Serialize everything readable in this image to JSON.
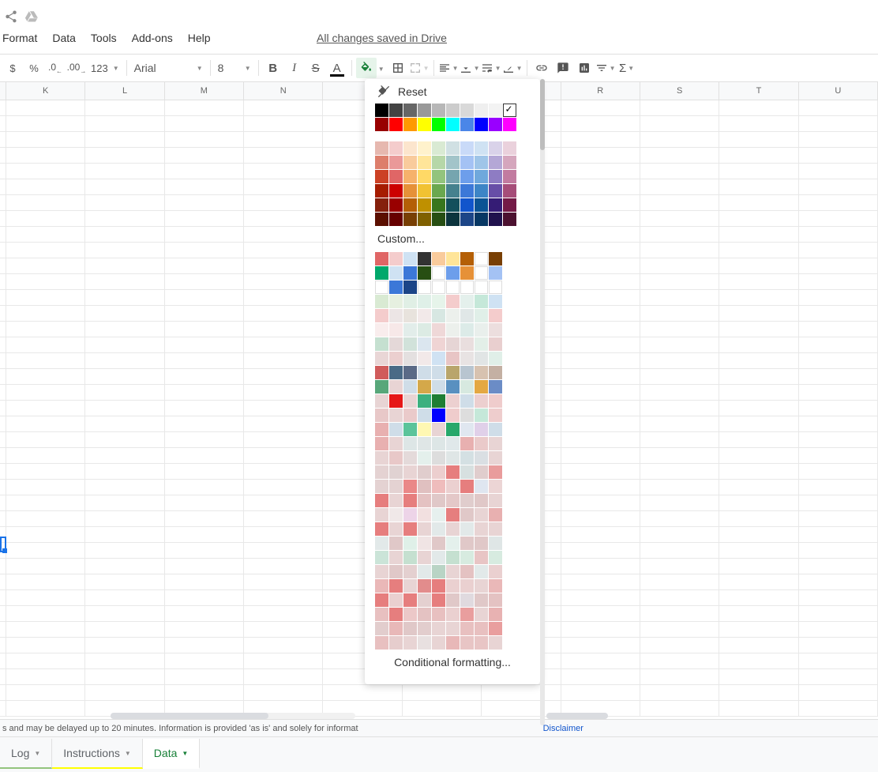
{
  "header": {
    "share_icon": "share-icon",
    "drive_icon": "drive-icon"
  },
  "menu": {
    "format": "Format",
    "data": "Data",
    "tools": "Tools",
    "addons": "Add-ons",
    "help": "Help"
  },
  "save_status": "All changes saved in Drive",
  "toolbar": {
    "percent": "%",
    "dec_less": ".0",
    "dec_more": ".00",
    "more_formats": "123",
    "font": "Arial",
    "size": "8"
  },
  "columns": [
    "K",
    "L",
    "M",
    "N",
    "",
    "",
    "R",
    "S",
    "T",
    "U"
  ],
  "color_picker": {
    "reset_label": "Reset",
    "custom_label": "Custom...",
    "conditional_label": "Conditional formatting...",
    "grays": [
      "#000000",
      "#434343",
      "#666666",
      "#999999",
      "#b7b7b7",
      "#cccccc",
      "#d9d9d9",
      "#efefef",
      "#f3f3f3",
      "#ffffff"
    ],
    "brights": [
      "#980000",
      "#ff0000",
      "#ff9900",
      "#ffff00",
      "#00ff00",
      "#00ffff",
      "#4a86e8",
      "#0000ff",
      "#9900ff",
      "#ff00ff"
    ],
    "palette": [
      [
        "#e6b8af",
        "#f4cccc",
        "#fce5cd",
        "#fff2cc",
        "#d9ead3",
        "#d0e0e3",
        "#c9daf8",
        "#cfe2f3",
        "#d9d2e9",
        "#ead1dc"
      ],
      [
        "#dd7e6b",
        "#ea9999",
        "#f9cb9c",
        "#ffe599",
        "#b6d7a8",
        "#a2c4c9",
        "#a4c2f4",
        "#9fc5e8",
        "#b4a7d6",
        "#d5a6bd"
      ],
      [
        "#cc4125",
        "#e06666",
        "#f6b26b",
        "#ffd966",
        "#93c47d",
        "#76a5af",
        "#6d9eeb",
        "#6fa8dc",
        "#8e7cc3",
        "#c27ba0"
      ],
      [
        "#a61c00",
        "#cc0000",
        "#e69138",
        "#f1c232",
        "#6aa84f",
        "#45818e",
        "#3c78d8",
        "#3d85c6",
        "#674ea7",
        "#a64d79"
      ],
      [
        "#85200c",
        "#990000",
        "#b45f06",
        "#bf9000",
        "#38761d",
        "#134f5c",
        "#1155cc",
        "#0b5394",
        "#351c75",
        "#741b47"
      ],
      [
        "#5b0f00",
        "#660000",
        "#783f04",
        "#7f6000",
        "#274e13",
        "#0c343d",
        "#1c4587",
        "#073763",
        "#20124d",
        "#4c1130"
      ]
    ],
    "custom_colors": [
      [
        "#e06666",
        "#f4cccc",
        "#cfe2f3",
        "#333333",
        "#f9cb9c",
        "#ffe599",
        "#b45f06",
        "#ffffff",
        "#783f04"
      ],
      [
        "#00a86b",
        "#cfe2f3",
        "#3c78d8",
        "#274e13",
        "#ffffff",
        "#6d9eeb",
        "#e69138",
        "#ffffff",
        "#a4c2f4"
      ],
      [
        "#ffffff",
        "#3c78d8",
        "#1c4587",
        "#ffffff",
        "#ffffff",
        "#ffffff",
        "#ffffff",
        "#ffffff",
        "#ffffff"
      ],
      [
        "#d9ead3",
        "#e6f0e0",
        "#e0efe5",
        "#dff0e8",
        "#e6f4ea",
        "#f4cccc",
        "#e4f0ec",
        "#c5e8d9",
        "#cfe2f3"
      ],
      [
        "#f4cccc",
        "#ece5e5",
        "#e8e3dd",
        "#f2e9e9",
        "#d7e7e2",
        "#ecf0ec",
        "#e0e7e7",
        "#e0efe8",
        "#f4cccc"
      ],
      [
        "#f9eded",
        "#f7e8e8",
        "#e2edea",
        "#dcebe4",
        "#efd8d8",
        "#ecf0ec",
        "#dcebe8",
        "#e9efec",
        "#ecdede"
      ],
      [
        "#c5e0d0",
        "#e4d8d8",
        "#d1e2da",
        "#dbe6ef",
        "#efd4d4",
        "#e6d5d5",
        "#e9dede",
        "#e3efe8",
        "#e9cfcf"
      ],
      [
        "#e9d6d6",
        "#ebcfcf",
        "#e4e0e0",
        "#f2e9e9",
        "#d0e2f3",
        "#e8c5c5",
        "#e8e3e3",
        "#e1e5e5",
        "#e0efe8"
      ],
      [
        "#d05b5b",
        "#4a6a86",
        "#5a6a86",
        "#cfdde8",
        "#cfdde8",
        "#b9a56b",
        "#b8c5d0",
        "#d7c2b0",
        "#c4b0a3"
      ],
      [
        "#58a77a",
        "#e8d4d4",
        "#cfdde8",
        "#d4a84a",
        "#cfdde8",
        "#5990c0",
        "#d7e9e0",
        "#e4a843",
        "#6b8cc6"
      ],
      [
        "#e8d4d4",
        "#e61717",
        "#e8d4d4",
        "#3bb07f",
        "#1e7e34",
        "#ecd0d0",
        "#cfdde8",
        "#eccfcf",
        "#efcccc"
      ],
      [
        "#e8c8c8",
        "#e8d4d4",
        "#eacaca",
        "#cfdde8",
        "#0000ff",
        "#efcccc",
        "#dddddd",
        "#c5e8d9",
        "#eecdcd"
      ],
      [
        "#e8b0b0",
        "#cfdde8",
        "#5bc49a",
        "#fff8b3",
        "#e8d4d4",
        "#27a86b",
        "#e0e7f0",
        "#e0d0e9",
        "#cfdde8"
      ],
      [
        "#e8b0b0",
        "#e8d4d4",
        "#dde6e6",
        "#dfe6e6",
        "#dde6e6",
        "#e0e8ea",
        "#e8b0b0",
        "#eacaca",
        "#e8d4d4"
      ],
      [
        "#e8d4d4",
        "#e8c8c8",
        "#e4dada",
        "#e4f0ec",
        "#dddddd",
        "#dfe6e6",
        "#d4e0e3",
        "#dadfe3",
        "#e8d4d4"
      ],
      [
        "#e4d2d2",
        "#e0d2d2",
        "#e8d4d4",
        "#e0cdcd",
        "#eccece",
        "#e67e7e",
        "#d7e0e0",
        "#e0cdcd",
        "#e99c9c"
      ],
      [
        "#e4d2d2",
        "#e4d2d2",
        "#ea8888",
        "#e0c0c0",
        "#efbcbc",
        "#ebd0d0",
        "#e67e7e",
        "#dfe6f0",
        "#ecd5d5"
      ],
      [
        "#e67e7e",
        "#e8d4d4",
        "#e67e7e",
        "#e4c2c2",
        "#e0c8c8",
        "#e4c8c8",
        "#e0cdcd",
        "#e0c8c8",
        "#e8d4d4"
      ],
      [
        "#e8d4d4",
        "#f0e8e8",
        "#edd4e8",
        "#f2e0e0",
        "#e6f0ee",
        "#e67e7e",
        "#e0c8c8",
        "#e8d4d4",
        "#e8b0b0"
      ],
      [
        "#e67e7e",
        "#e8d4d4",
        "#e67e7e",
        "#e8d4d4",
        "#e2e9e9",
        "#e8d4d4",
        "#e2e9e9",
        "#e8d4d4",
        "#e8d4d4"
      ],
      [
        "#e2e9e9",
        "#e0c8c8",
        "#dff0e8",
        "#f0e4e4",
        "#e0c8c8",
        "#e4f0ec",
        "#e0c8c8",
        "#e0c8c8",
        "#dfe6e6"
      ],
      [
        "#cbe4d8",
        "#e8d4d4",
        "#c5e0d0",
        "#e8d4d4",
        "#e2e9e9",
        "#c5e0d0",
        "#d7ebe0",
        "#e8c5c5",
        "#d7ebe0"
      ],
      [
        "#e8d4d4",
        "#e0c8c8",
        "#e4d0d0",
        "#e2e9e9",
        "#b9d4c5",
        "#e8d4d4",
        "#e4c2c2",
        "#e2e9e9",
        "#ead0d0"
      ],
      [
        "#eab8b8",
        "#e67e7e",
        "#e8d4d4",
        "#e28c8c",
        "#e67e7e",
        "#ead0d0",
        "#ead0d0",
        "#e8d4d4",
        "#eab8b8"
      ],
      [
        "#e67e7e",
        "#ead0d0",
        "#e67e7e",
        "#e4d0d0",
        "#e67e7e",
        "#e0c8c8",
        "#e0dadf",
        "#e0c8c8",
        "#e4c2c2"
      ],
      [
        "#e8c0c0",
        "#e67e7e",
        "#ecc8c8",
        "#e4c2c2",
        "#e8c0c0",
        "#ead0d0",
        "#e99e9e",
        "#e8d4d4",
        "#e8b2b2"
      ],
      [
        "#e2cdcd",
        "#e8b8b8",
        "#e0c8c8",
        "#e2cdcd",
        "#e8d4d4",
        "#e8d4d4",
        "#e8c0c0",
        "#e8c0c0",
        "#e99e9e"
      ],
      [
        "#e8c0c0",
        "#e6cdcd",
        "#e8d4d4",
        "#e8e0e0",
        "#e8d4d4",
        "#e8b8b8",
        "#e8c5c5",
        "#e8c5c5",
        "#e8d4d4"
      ]
    ]
  },
  "disclaimer": {
    "text": "s and may be delayed up to 20 minutes. Information is provided 'as is' and solely for informat",
    "link": "Disclaimer"
  },
  "tabs": {
    "log": "Log",
    "instructions": "Instructions",
    "data": "Data"
  }
}
